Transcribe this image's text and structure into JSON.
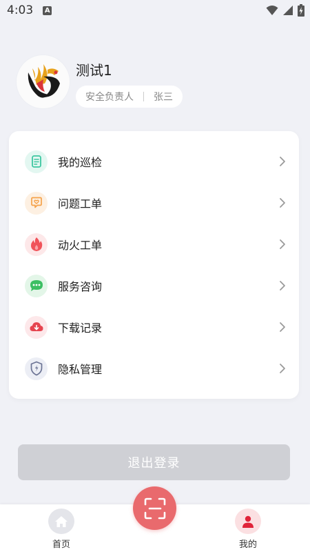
{
  "status_bar": {
    "time": "4:03",
    "badge": "A",
    "icons": [
      "wifi-icon",
      "signal-icon",
      "battery-icon"
    ]
  },
  "profile": {
    "name": "测试1",
    "role": "安全负责人",
    "person": "张三"
  },
  "menu": {
    "items": [
      {
        "label": "我的巡检",
        "icon": "inspection-doc-icon",
        "color": "#3cc6a0",
        "bg": "#e3f7f1"
      },
      {
        "label": "问题工单",
        "icon": "issue-chat-icon",
        "color": "#f5a24a",
        "bg": "#fdf0e2"
      },
      {
        "label": "动火工单",
        "icon": "fire-icon",
        "color": "#f0535a",
        "bg": "#fde8e9"
      },
      {
        "label": "服务咨询",
        "icon": "service-chat-icon",
        "color": "#3cbf63",
        "bg": "#e3f6e8"
      },
      {
        "label": "下载记录",
        "icon": "cloud-download-icon",
        "color": "#e6444f",
        "bg": "#fde8ea"
      },
      {
        "label": "隐私管理",
        "icon": "shield-icon",
        "color": "#6b7394",
        "bg": "#eceef5"
      }
    ]
  },
  "logout": {
    "label": "退出登录"
  },
  "tabbar": {
    "home_label": "首页",
    "mine_label": "我的",
    "scan_icon": "scan-icon"
  },
  "colors": {
    "accent": "#e96a6d",
    "background": "#f0f1f6",
    "logout_disabled": "#cfd0d5"
  }
}
